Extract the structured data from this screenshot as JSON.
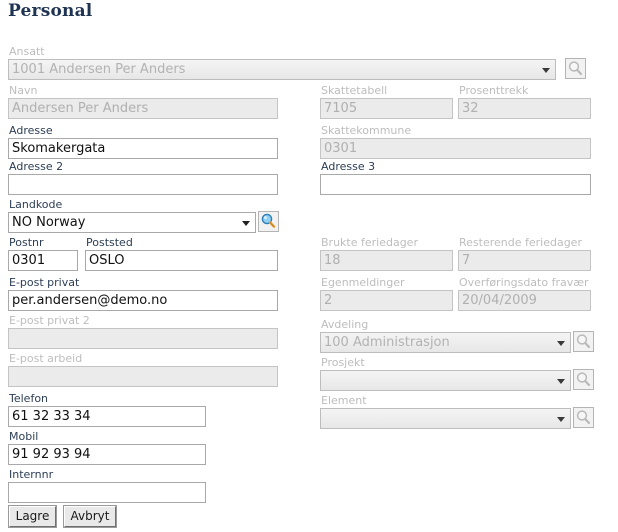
{
  "page": {
    "title": "Personal"
  },
  "top": {
    "ansatt": {
      "label": "Ansatt",
      "value": "1001 Andersen Per Anders",
      "lookup_icon": "magnifier-icon"
    }
  },
  "left": {
    "navn": {
      "label": "Navn",
      "value": "Andersen Per Anders"
    },
    "adresse": {
      "label": "Adresse",
      "value": "Skomakergata"
    },
    "adresse2": {
      "label": "Adresse 2",
      "value": ""
    },
    "landkode": {
      "label": "Landkode",
      "value": "NO Norway",
      "lookup_icon": "magnifier-icon"
    },
    "postnr": {
      "label": "Postnr",
      "value": "0301"
    },
    "poststed": {
      "label": "Poststed",
      "value": "OSLO"
    },
    "epost_privat": {
      "label": "E-post privat",
      "value": "per.andersen@demo.no"
    },
    "epost_privat_2": {
      "label": "E-post privat 2",
      "value": ""
    },
    "epost_arbeid": {
      "label": "E-post arbeid",
      "value": ""
    },
    "telefon": {
      "label": "Telefon",
      "value": "61 32 33 34"
    },
    "mobil": {
      "label": "Mobil",
      "value": "91 92 93 94"
    },
    "internnr": {
      "label": "Internnr",
      "value": ""
    }
  },
  "right": {
    "skattetabell": {
      "label": "Skattetabell",
      "value": "7105"
    },
    "prosenttrekk": {
      "label": "Prosenttrekk",
      "value": "32"
    },
    "skattekommune": {
      "label": "Skattekommune",
      "value": "0301"
    },
    "adresse3": {
      "label": "Adresse 3",
      "value": ""
    },
    "brukte_feriedager": {
      "label": "Brukte feriedager",
      "value": "18"
    },
    "resterende_feriedager": {
      "label": "Resterende feriedager",
      "value": "7"
    },
    "egenmeldinger": {
      "label": "Egenmeldinger",
      "value": "2"
    },
    "overforingsdato": {
      "label": "Overføringsdato fravær",
      "value": "20/04/2009"
    },
    "avdeling": {
      "label": "Avdeling",
      "value": "100 Administrasjon",
      "lookup_icon": "magnifier-icon"
    },
    "prosjekt": {
      "label": "Prosjekt",
      "value": "",
      "lookup_icon": "magnifier-icon"
    },
    "element": {
      "label": "Element",
      "value": "",
      "lookup_icon": "magnifier-icon"
    }
  },
  "actions": {
    "save_label": "Lagre",
    "cancel_label": "Avbryt"
  },
  "colors": {
    "title": "#1f3352",
    "label_enabled": "#2c3e55",
    "label_disabled": "#bdbdbd",
    "field_disabled_bg": "#ebebeb",
    "lens_active": "#58a6dd",
    "handle_active": "#e8a33d",
    "lens_disabled": "#b9b9b9"
  }
}
